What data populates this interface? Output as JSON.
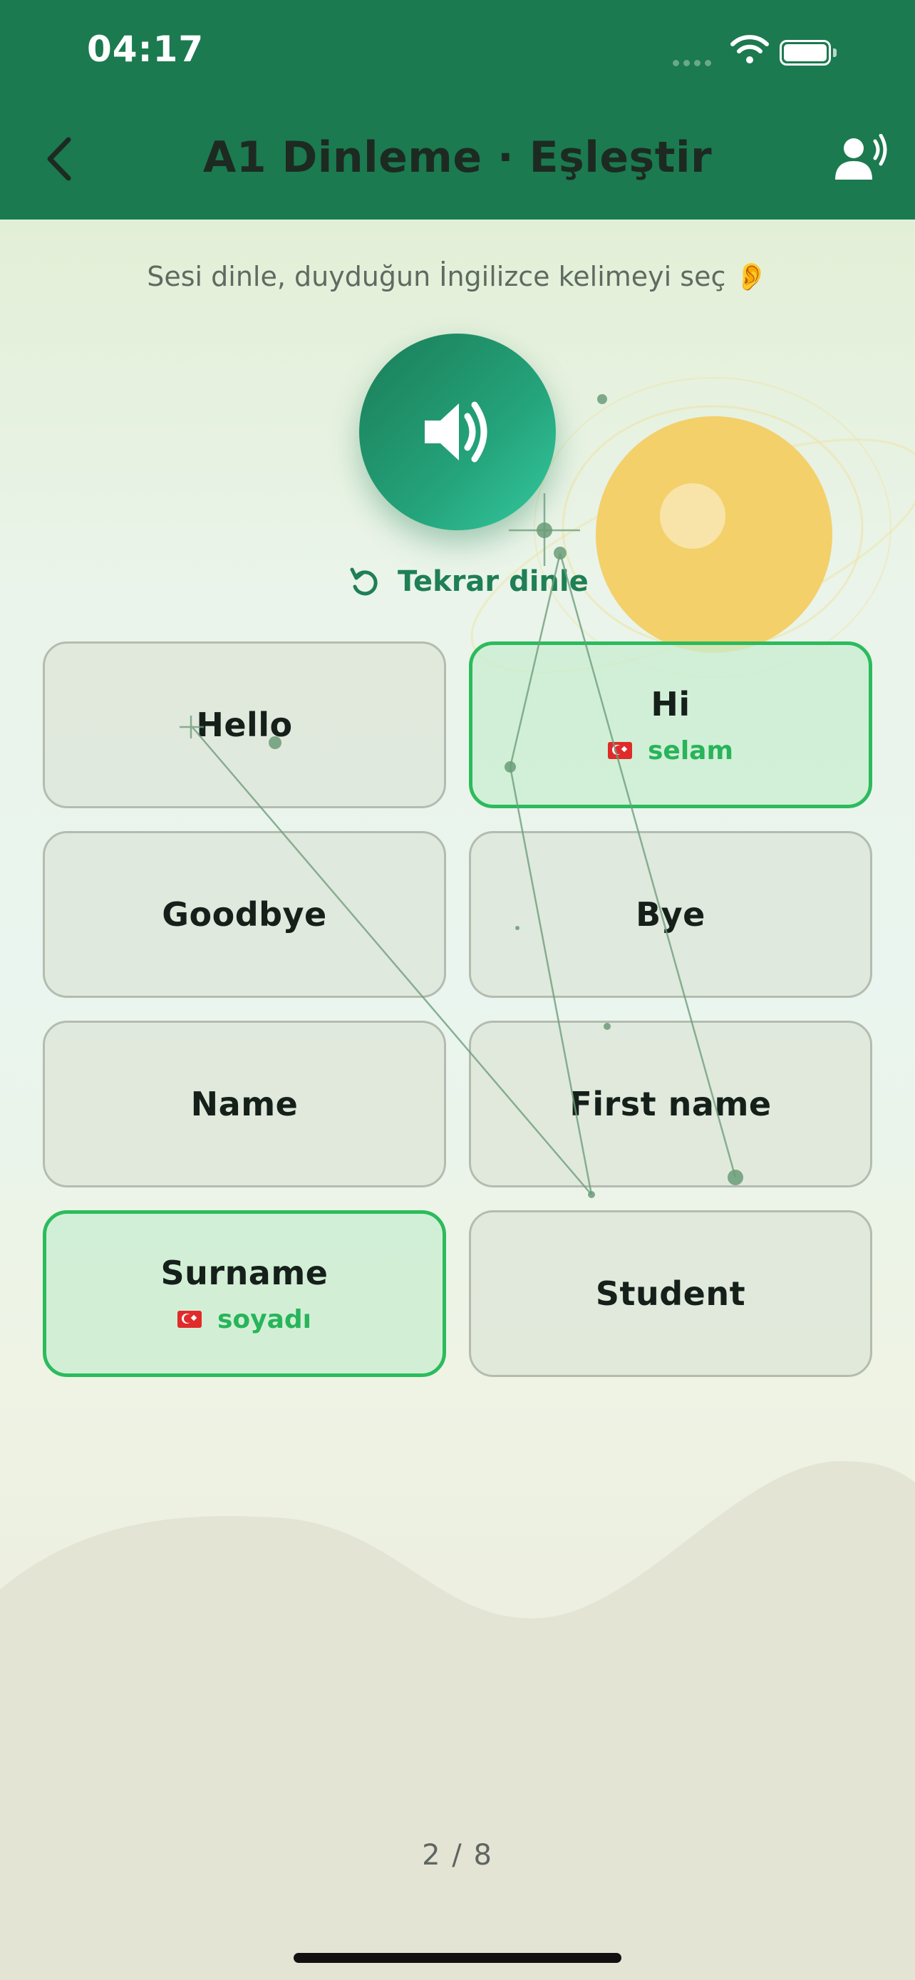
{
  "status": {
    "time": "04:17"
  },
  "header": {
    "title": "A1 Dinleme · Eşleştir"
  },
  "instruction": "Sesi dinle, duyduğun İngilizce kelimeyi seç 👂",
  "replay_label": "Tekrar dinle",
  "cards": [
    {
      "word": "Hello",
      "translation": "",
      "matched": false
    },
    {
      "word": "Hi",
      "translation": "selam",
      "matched": true
    },
    {
      "word": "Goodbye",
      "translation": "",
      "matched": false
    },
    {
      "word": "Bye",
      "translation": "",
      "matched": false
    },
    {
      "word": "Name",
      "translation": "",
      "matched": false
    },
    {
      "word": "First name",
      "translation": "",
      "matched": false
    },
    {
      "word": "Surname",
      "translation": "soyadı",
      "matched": true
    },
    {
      "word": "Student",
      "translation": "",
      "matched": false
    }
  ],
  "progress": "2 / 8",
  "colors": {
    "header": "#1b7a4f",
    "accent": "#2cbb5c",
    "sun": "#f3d06a"
  },
  "icons": [
    "back-chevron-icon",
    "voice-speaker-icon",
    "speaker-icon",
    "replay-icon",
    "turkey-flag-icon",
    "wifi-icon",
    "battery-icon"
  ]
}
